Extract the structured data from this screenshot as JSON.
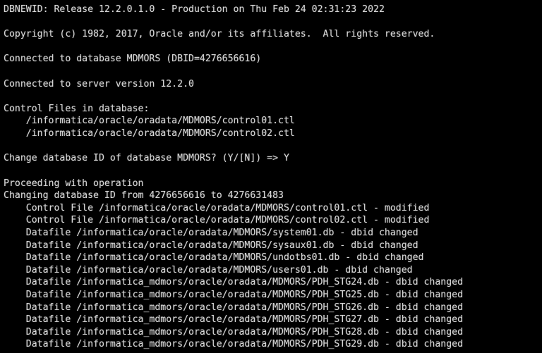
{
  "terminal": {
    "window_title": "DBNEWID Terminal Output",
    "background_color": "#000000",
    "text_color": "#d6d6d6",
    "program": "DBNEWID",
    "lines": [
      "DBNEWID: Release 12.2.0.1.0 - Production on Thu Feb 24 02:31:23 2022",
      "",
      "Copyright (c) 1982, 2017, Oracle and/or its affiliates.  All rights reserved.",
      "",
      "Connected to database MDMORS (DBID=4276656616)",
      "",
      "Connected to server version 12.2.0",
      "",
      "Control Files in database:",
      "    /informatica/oracle/oradata/MDMORS/control01.ctl",
      "    /informatica/oracle/oradata/MDMORS/control02.ctl",
      "",
      "Change database ID of database MDMORS? (Y/[N]) => Y",
      "",
      "Proceeding with operation",
      "Changing database ID from 4276656616 to 4276631483",
      "    Control File /informatica/oracle/oradata/MDMORS/control01.ctl - modified",
      "    Control File /informatica/oracle/oradata/MDMORS/control02.ctl - modified",
      "    Datafile /informatica/oracle/oradata/MDMORS/system01.db - dbid changed",
      "    Datafile /informatica/oracle/oradata/MDMORS/sysaux01.db - dbid changed",
      "    Datafile /informatica/oracle/oradata/MDMORS/undotbs01.db - dbid changed",
      "    Datafile /informatica/oracle/oradata/MDMORS/users01.db - dbid changed",
      "    Datafile /informatica_mdmors/oracle/oradata/MDMORS/PDH_STG24.db - dbid changed",
      "    Datafile /informatica_mdmors/oracle/oradata/MDMORS/PDH_STG25.db - dbid changed",
      "    Datafile /informatica_mdmors/oracle/oradata/MDMORS/PDH_STG26.db - dbid changed",
      "    Datafile /informatica_mdmors/oracle/oradata/MDMORS/PDH_STG27.db - dbid changed",
      "    Datafile /informatica_mdmors/oracle/oradata/MDMORS/PDH_STG28.db - dbid changed",
      "    Datafile /informatica_mdmors/oracle/oradata/MDMORS/PDH_STG29.db - dbid changed"
    ],
    "header": {
      "release_line": "DBNEWID: Release 12.2.0.1.0 - Production on Thu Feb 24 02:31:23 2022",
      "release_version": "12.2.0.1.0",
      "build_type": "Production",
      "timestamp": "Thu Feb 24 02:31:23 2022",
      "copyright": "Copyright (c) 1982, 2017, Oracle and/or its affiliates.  All rights reserved."
    },
    "connection": {
      "database_name": "MDMORS",
      "database_dbid": "4276656616",
      "connected_database_line": "Connected to database MDMORS (DBID=4276656616)",
      "server_version": "12.2.0",
      "connected_server_line": "Connected to server version 12.2.0"
    },
    "control_files": {
      "heading": "Control Files in database:",
      "paths": [
        "/informatica/oracle/oradata/MDMORS/control01.ctl",
        "/informatica/oracle/oradata/MDMORS/control02.ctl"
      ]
    },
    "prompt": {
      "question": "Change database ID of database MDMORS? (Y/[N]) => Y",
      "options": "(Y/[N])",
      "default_option": "N",
      "answer": "Y"
    },
    "operation": {
      "status": "Proceeding with operation",
      "change_line": "Changing database ID from 4276656616 to 4276631483",
      "old_dbid": "4276656616",
      "new_dbid": "4276631483",
      "results": [
        {
          "kind": "Control File",
          "path": "/informatica/oracle/oradata/MDMORS/control01.ctl",
          "status": "modified"
        },
        {
          "kind": "Control File",
          "path": "/informatica/oracle/oradata/MDMORS/control02.ctl",
          "status": "modified"
        },
        {
          "kind": "Datafile",
          "path": "/informatica/oracle/oradata/MDMORS/system01.db",
          "status": "dbid changed"
        },
        {
          "kind": "Datafile",
          "path": "/informatica/oracle/oradata/MDMORS/sysaux01.db",
          "status": "dbid changed"
        },
        {
          "kind": "Datafile",
          "path": "/informatica/oracle/oradata/MDMORS/undotbs01.db",
          "status": "dbid changed"
        },
        {
          "kind": "Datafile",
          "path": "/informatica/oracle/oradata/MDMORS/users01.db",
          "status": "dbid changed"
        },
        {
          "kind": "Datafile",
          "path": "/informatica_mdmors/oracle/oradata/MDMORS/PDH_STG24.db",
          "status": "dbid changed"
        },
        {
          "kind": "Datafile",
          "path": "/informatica_mdmors/oracle/oradata/MDMORS/PDH_STG25.db",
          "status": "dbid changed"
        },
        {
          "kind": "Datafile",
          "path": "/informatica_mdmors/oracle/oradata/MDMORS/PDH_STG26.db",
          "status": "dbid changed"
        },
        {
          "kind": "Datafile",
          "path": "/informatica_mdmors/oracle/oradata/MDMORS/PDH_STG27.db",
          "status": "dbid changed"
        },
        {
          "kind": "Datafile",
          "path": "/informatica_mdmors/oracle/oradata/MDMORS/PDH_STG28.db",
          "status": "dbid changed"
        },
        {
          "kind": "Datafile",
          "path": "/informatica_mdmors/oracle/oradata/MDMORS/PDH_STG29.db",
          "status": "dbid changed"
        }
      ]
    }
  }
}
